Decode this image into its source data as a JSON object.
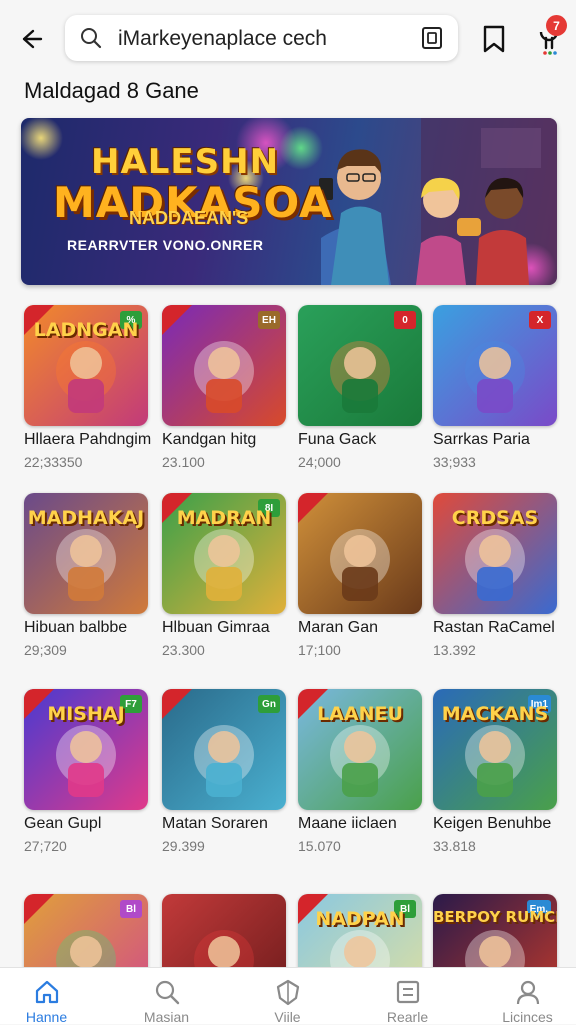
{
  "header": {
    "search_text": "iMarkeyenaplace cech",
    "notification_count": "7"
  },
  "section_title": "Maldagad 8 Gane",
  "banner": {
    "title_line1": "HALESHN",
    "title_line2": "MADKASOA",
    "title_line3": "NADDAEAN'S",
    "subtitle": "REARRVTER VONO.ONRER"
  },
  "games": [
    {
      "name": "Hllaera Pahdngim",
      "count": "22;33350",
      "tag": "%",
      "tag_color": "#2e9e3a",
      "ribbon": "#d4252b",
      "art": "LADNGAN"
    },
    {
      "name": "Kandgan hitg",
      "count": "23.100",
      "tag": "EH",
      "tag_color": "#9a6a2a",
      "ribbon": "#d4252b",
      "art": ""
    },
    {
      "name": "Funa Gack",
      "count": "24;000",
      "tag": "0",
      "tag_color": "#d4252b",
      "ribbon": "",
      "art": ""
    },
    {
      "name": "Sarrkas Paria",
      "count": "33;933",
      "tag": "X",
      "tag_color": "#d4252b",
      "ribbon": "",
      "art": ""
    },
    {
      "name": "Hibuan balbbe",
      "count": "29;309",
      "tag": "",
      "tag_color": "",
      "ribbon": "",
      "art": "MADHAKAJ"
    },
    {
      "name": "Hlbuan Gimraa",
      "count": "23.300",
      "tag": "8I",
      "tag_color": "#2e9e3a",
      "ribbon": "#d4252b",
      "art": "MADRAN"
    },
    {
      "name": "Maran Gan",
      "count": "17;100",
      "tag": "",
      "tag_color": "",
      "ribbon": "#d4252b",
      "art": ""
    },
    {
      "name": "Rastan RaCamel",
      "count": "13.392",
      "tag": "",
      "tag_color": "",
      "ribbon": "",
      "art": "CRDSAS"
    },
    {
      "name": "Gean Gupl",
      "count": "27;720",
      "tag": "F7",
      "tag_color": "#2e9e3a",
      "ribbon": "#d4252b",
      "art": "MISHAJ"
    },
    {
      "name": "Matan Soraren",
      "count": "29.399",
      "tag": "Gn",
      "tag_color": "#2e9e3a",
      "ribbon": "#d4252b",
      "art": ""
    },
    {
      "name": "Maane iiclaen",
      "count": "15.070",
      "tag": "",
      "tag_color": "",
      "ribbon": "#d4252b",
      "art": "LAANEU"
    },
    {
      "name": "Keigen Benuhbe",
      "count": "33.818",
      "tag": "Im1",
      "tag_color": "#2a8ad4",
      "ribbon": "",
      "art": "MACKANS"
    },
    {
      "name": "",
      "count": "",
      "tag": "Bl",
      "tag_color": "#b04ac8",
      "ribbon": "#d4252b",
      "art": ""
    },
    {
      "name": "",
      "count": "",
      "tag": "",
      "tag_color": "",
      "ribbon": "",
      "art": ""
    },
    {
      "name": "",
      "count": "",
      "tag": "Bl",
      "tag_color": "#2e9e3a",
      "ribbon": "#d4252b",
      "art": "NADPAN"
    },
    {
      "name": "",
      "count": "",
      "tag": "Em.",
      "tag_color": "#2a8ad4",
      "ribbon": "",
      "art": "BERPOY RUMCK"
    }
  ],
  "nav": [
    {
      "label": "Hanne",
      "icon": "home-icon",
      "active": true
    },
    {
      "label": "Masian",
      "icon": "search-icon",
      "active": false
    },
    {
      "label": "Viile",
      "icon": "shield-icon",
      "active": false
    },
    {
      "label": "Rearle",
      "icon": "document-icon",
      "active": false
    },
    {
      "label": "Licinces",
      "icon": "profile-icon",
      "active": false
    }
  ],
  "colors": {
    "accent": "#2b7ce0",
    "badge": "#e53935"
  }
}
